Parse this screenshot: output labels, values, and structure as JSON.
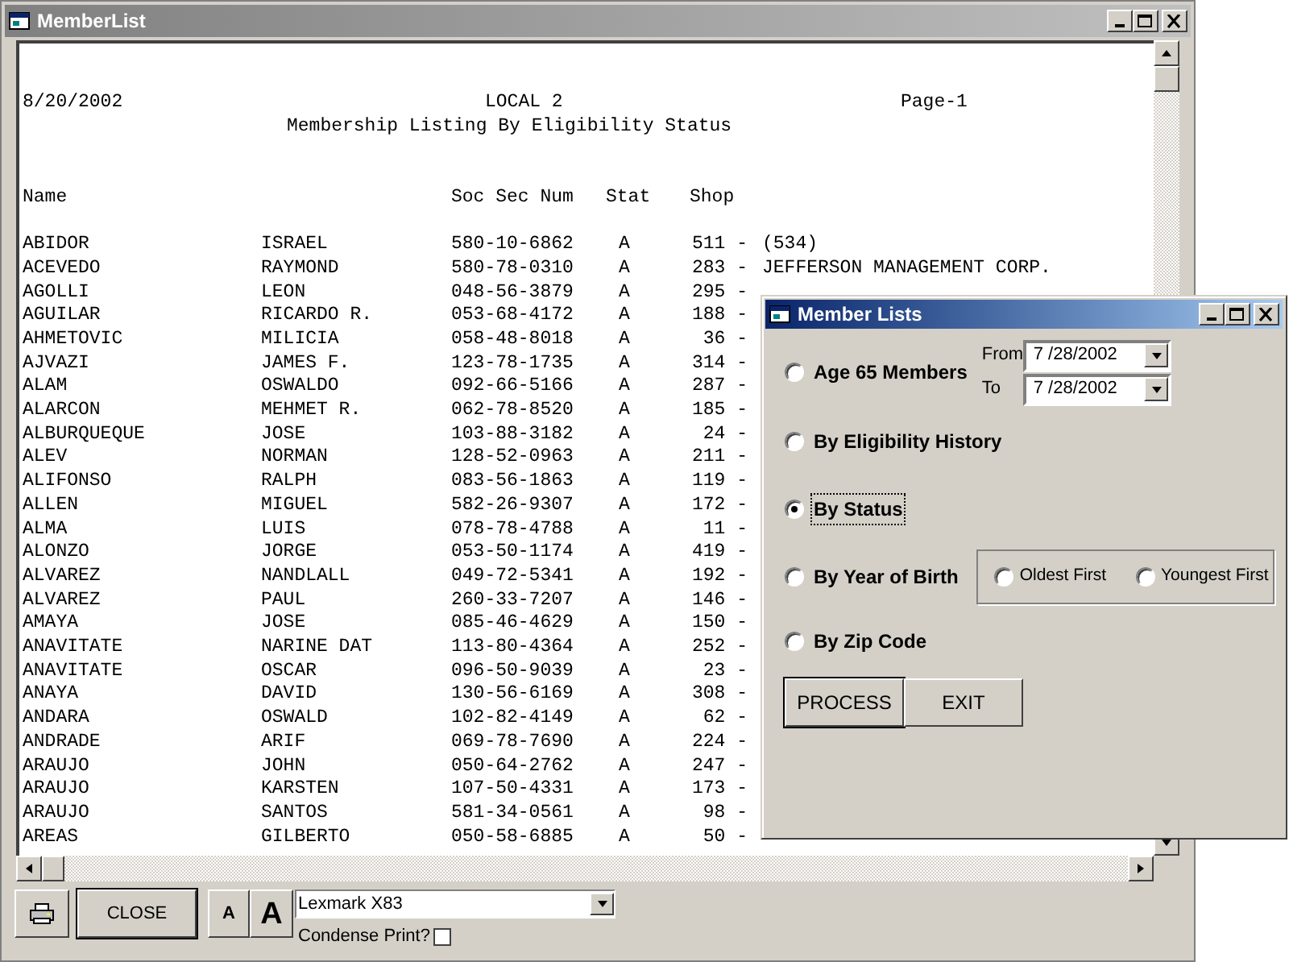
{
  "window": {
    "title": "MemberList"
  },
  "report": {
    "date": "8/20/2002",
    "org": "LOCAL 2",
    "page": "Page-1",
    "title": "Membership Listing By Eligibility Status",
    "columns": [
      "Name",
      "Soc Sec Num",
      "Stat",
      "Shop"
    ],
    "rows": [
      {
        "last": "ABIDOR",
        "first": "ISRAEL",
        "ssn": "580-10-6862",
        "stat": "A",
        "shop": "511 -",
        "company": "(534)"
      },
      {
        "last": "ACEVEDO",
        "first": "RAYMOND",
        "ssn": "580-78-0310",
        "stat": "A",
        "shop": "283 -",
        "company": "JEFFERSON MANAGEMENT CORP."
      },
      {
        "last": "AGOLLI",
        "first": "LEON",
        "ssn": "048-56-3879",
        "stat": "A",
        "shop": "295 -"
      },
      {
        "last": "AGUILAR",
        "first": "RICARDO R.",
        "ssn": "053-68-4172",
        "stat": "A",
        "shop": "188 -"
      },
      {
        "last": "AHMETOVIC",
        "first": "MILICIA",
        "ssn": "058-48-8018",
        "stat": "A",
        "shop": "36 -"
      },
      {
        "last": "AJVAZI",
        "first": "JAMES F.",
        "ssn": "123-78-1735",
        "stat": "A",
        "shop": "314 -"
      },
      {
        "last": "ALAM",
        "first": "OSWALDO",
        "ssn": "092-66-5166",
        "stat": "A",
        "shop": "287 -"
      },
      {
        "last": "ALARCON",
        "first": "MEHMET R.",
        "ssn": "062-78-8520",
        "stat": "A",
        "shop": "185 -"
      },
      {
        "last": "ALBURQUEQUE",
        "first": "JOSE",
        "ssn": "103-88-3182",
        "stat": "A",
        "shop": "24 -"
      },
      {
        "last": "ALEV",
        "first": "NORMAN",
        "ssn": "128-52-0963",
        "stat": "A",
        "shop": "211 -"
      },
      {
        "last": "ALIFONSO",
        "first": "RALPH",
        "ssn": "083-56-1863",
        "stat": "A",
        "shop": "119 -"
      },
      {
        "last": "ALLEN",
        "first": "MIGUEL",
        "ssn": "582-26-9307",
        "stat": "A",
        "shop": "172 -"
      },
      {
        "last": "ALMA",
        "first": "LUIS",
        "ssn": "078-78-4788",
        "stat": "A",
        "shop": "11 -"
      },
      {
        "last": "ALONZO",
        "first": "JORGE",
        "ssn": "053-50-1174",
        "stat": "A",
        "shop": "419 -"
      },
      {
        "last": "ALVAREZ",
        "first": "NANDLALL",
        "ssn": "049-72-5341",
        "stat": "A",
        "shop": "192 -"
      },
      {
        "last": "ALVAREZ",
        "first": "PAUL",
        "ssn": "260-33-7207",
        "stat": "A",
        "shop": "146 -"
      },
      {
        "last": "AMAYA",
        "first": "JOSE",
        "ssn": "085-46-4629",
        "stat": "A",
        "shop": "150 -"
      },
      {
        "last": "ANAVITATE",
        "first": "NARINE DAT",
        "ssn": "113-80-4364",
        "stat": "A",
        "shop": "252 -"
      },
      {
        "last": "ANAVITATE",
        "first": "OSCAR",
        "ssn": "096-50-9039",
        "stat": "A",
        "shop": "23 -"
      },
      {
        "last": "ANAYA",
        "first": "DAVID",
        "ssn": "130-56-6169",
        "stat": "A",
        "shop": "308 -"
      },
      {
        "last": "ANDARA",
        "first": "OSWALD",
        "ssn": "102-82-4149",
        "stat": "A",
        "shop": "62 -"
      },
      {
        "last": "ANDRADE",
        "first": "ARIF",
        "ssn": "069-78-7690",
        "stat": "A",
        "shop": "224 -"
      },
      {
        "last": "ARAUJO",
        "first": "JOHN",
        "ssn": "050-64-2762",
        "stat": "A",
        "shop": "247 -"
      },
      {
        "last": "ARAUJO",
        "first": "KARSTEN",
        "ssn": "107-50-4331",
        "stat": "A",
        "shop": "173 -"
      },
      {
        "last": "ARAUJO",
        "first": "SANTOS",
        "ssn": "581-34-0561",
        "stat": "A",
        "shop": "98 -"
      },
      {
        "last": "AREAS",
        "first": "GILBERTO",
        "ssn": "050-58-6885",
        "stat": "A",
        "shop": "50 -"
      }
    ]
  },
  "toolbar": {
    "close": "CLOSE",
    "font_small": "A",
    "font_large": "A",
    "printer": "Lexmark X83",
    "condense_label": "Condense Print?",
    "condense_checked": false
  },
  "dialog": {
    "title": "Member Lists",
    "options": [
      {
        "label": "Age 65 Members",
        "selected": false,
        "focused": false,
        "date_range": {
          "from_label": "From",
          "from": "7 /28/2002",
          "to_label": "To",
          "to": "7 /28/2002"
        }
      },
      {
        "label": "By Eligibility History",
        "selected": false,
        "focused": false
      },
      {
        "label": "By Status",
        "selected": true,
        "focused": true
      },
      {
        "label": "By Year of Birth",
        "selected": false,
        "focused": false,
        "order": [
          {
            "label": "Oldest First",
            "selected": false
          },
          {
            "label": "Youngest First",
            "selected": false
          }
        ]
      },
      {
        "label": "By Zip Code",
        "selected": false,
        "focused": false
      }
    ],
    "buttons": [
      "PROCESS",
      "EXIT"
    ]
  }
}
